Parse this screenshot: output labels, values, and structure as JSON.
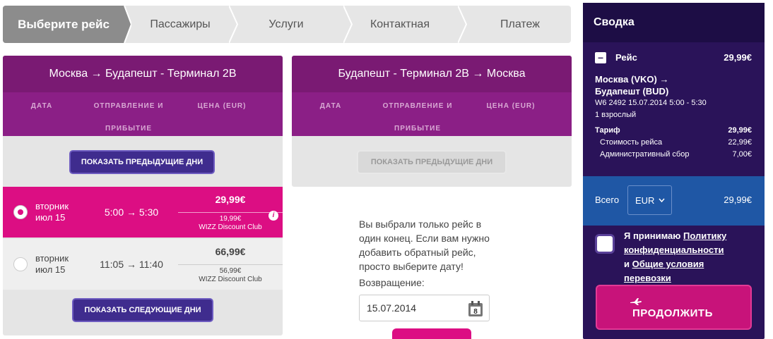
{
  "steps": [
    "Выберите рейс",
    "Пассажиры",
    "Услуги",
    "Контактная",
    "Платеж"
  ],
  "outbound": {
    "title": "Москва → Будапешт - Терминал 2В",
    "col_date": "ДАТА",
    "col_dep1": "ОТПРАВЛЕНИЕ И",
    "col_dep2": "ПРИБЫТИЕ",
    "col_price": "ЦЕНА (EUR)",
    "prev_btn": "ПОКАЗАТЬ ПРЕДЫДУЩИЕ ДНИ",
    "next_btn": "ПОКАЗАТЬ СЛЕДУЮЩИЕ ДНИ",
    "flights": [
      {
        "day": "вторник",
        "date": "июл 15",
        "time": "5:00 → 5:30",
        "price": "29,99€",
        "club_price": "19,99€",
        "club": "WIZZ Discount Club",
        "selected": true
      },
      {
        "day": "вторник",
        "date": "июл 15",
        "time": "11:05 → 11:40",
        "price": "66,99€",
        "club_price": "56,99€",
        "club": "WIZZ Discount Club",
        "selected": false
      }
    ]
  },
  "return": {
    "title": "Будапешт - Терминал 2В → Москва",
    "col_date": "ДАТА",
    "col_dep1": "ОТПРАВЛЕНИЕ И",
    "col_dep2": "ПРИБЫТИЕ",
    "col_price": "ЦЕНА (EUR)",
    "prev_btn": "ПОКАЗАТЬ ПРЕДЫДУЩИЕ ДНИ",
    "message": [
      "Вы выбрали только рейс в",
      "один конец. Если вам нужно",
      "добавить обратный рейс,",
      "просто выберите дату!"
    ],
    "return_label": "Возвращение:",
    "return_date": "15.07.2014",
    "calendar_day": "8"
  },
  "summary": {
    "title": "Сводка",
    "flight_label": "Рейс",
    "flight_price": "29,99€",
    "toggle": "–",
    "route1": "Москва (VKO) →",
    "route2": "Будапешт (BUD)",
    "details": "W6 2492  15.07.2014 5:00 - 5:30",
    "passengers": "1 взрослый",
    "tariff_label": "Тариф",
    "tariff_value": "29,99€",
    "cost_label": "Стоимость рейса",
    "cost_value": "22,99€",
    "fee_label": "Административный сбор",
    "fee_value": "7,00€",
    "total_label": "Всего",
    "currency": "EUR",
    "total_value": "29,99€",
    "accept_prefix": "Я принимаю ",
    "privacy_link1": "Политику",
    "privacy_link2": "конфиденциальности",
    "and_text": "и ",
    "terms_link1": "Общие условия",
    "terms_link2": "перевозки",
    "continue_btn": "ПРОДОЛЖИТЬ"
  },
  "colors": {
    "purple": "#7a1a73",
    "pink": "#dc0e83",
    "navy": "#2a1359",
    "blue": "#1f57a5"
  }
}
